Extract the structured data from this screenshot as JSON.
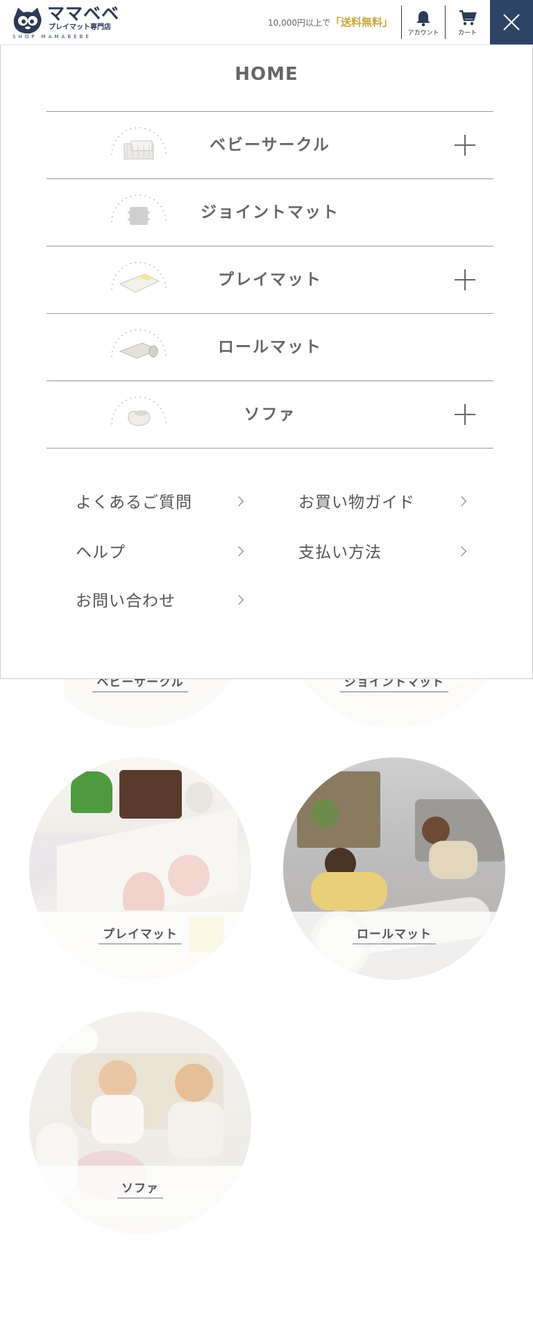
{
  "header": {
    "logo_title": "ママベベ",
    "logo_sub": "プレイマット専門店",
    "logo_en": "SHOP MAMABEBE",
    "shipping_text": "10,000円以上で",
    "shipping_free": "「送料無料」",
    "account_label": "アカウント",
    "cart_label": "カート",
    "account_icon": "bell-icon",
    "cart_icon": "cart-icon",
    "close_icon": "close-icon"
  },
  "drawer": {
    "home_label": "HOME",
    "categories": [
      {
        "label": "ベビーサークル",
        "icon": "baby-circle-icon",
        "expandable": true
      },
      {
        "label": "ジョイントマット",
        "icon": "joint-mat-icon",
        "expandable": false
      },
      {
        "label": "プレイマット",
        "icon": "play-mat-icon",
        "expandable": true
      },
      {
        "label": "ロールマット",
        "icon": "roll-mat-icon",
        "expandable": false
      },
      {
        "label": "ソファ",
        "icon": "sofa-icon",
        "expandable": true
      }
    ],
    "links": [
      {
        "label": "よくあるご質問"
      },
      {
        "label": "お買い物ガイド"
      },
      {
        "label": "ヘルプ"
      },
      {
        "label": "支払い方法"
      },
      {
        "label": "お問い合わせ"
      }
    ]
  },
  "category_tiles": [
    {
      "label": "ベビーサークル"
    },
    {
      "label": "ジョイントマット"
    },
    {
      "label": "プレイマット"
    },
    {
      "label": "ロールマット"
    },
    {
      "label": "ソファ"
    }
  ],
  "colors": {
    "brand_navy": "#2e4466",
    "shipping_gold": "#c8a93a"
  }
}
